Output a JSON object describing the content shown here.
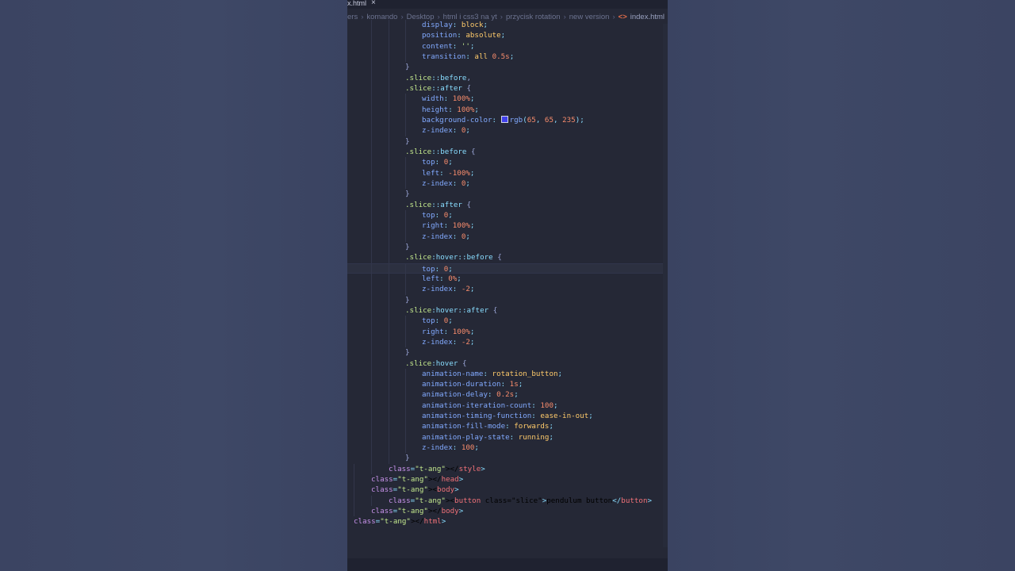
{
  "tab": {
    "title": "x.html",
    "close": "×"
  },
  "breadcrumbs": {
    "items": [
      "ers",
      "komando",
      "Desktop",
      "html i css3 na yt",
      "przycisk rotation",
      "new version"
    ],
    "file": "index.html"
  },
  "colors": {
    "swatch": "#4141eb",
    "accent": "#6a8cff"
  },
  "code_lines": [
    "display: block;",
    "position: absolute;",
    "content: '';",
    "transition: all 0.5s;",
    "}",
    ".slice::before,",
    ".slice::after {",
    "width: 100%;",
    "height: 100%;",
    "background-color: rgb(65, 65, 235);",
    "z-index: 0;",
    "}",
    ".slice::before {",
    "top: 0;",
    "left: -100%;",
    "z-index: 0;",
    "}",
    ".slice::after {",
    "top: 0;",
    "right: 100%;",
    "z-index: 0;",
    "}",
    ".slice:hover::before {",
    "top: 0;",
    "left: 0%;",
    "z-index: -2;",
    "}",
    ".slice:hover::after {",
    "top: 0;",
    "right: 100%;",
    "z-index: -2;",
    "}",
    ".slice:hover {",
    "animation-name: rotation_button;",
    "animation-duration: 1s;",
    "animation-delay: 0.2s;",
    "animation-iteration-count: 100;",
    "animation-timing-function: ease-in-out;",
    "animation-fill-mode: forwards;",
    "animation-play-state: running;",
    "z-index: 100;",
    "}",
    "</style>",
    "</head>",
    "<body>",
    "<button class=\"slice\">pendulum button</button>",
    "</body>",
    "</html>"
  ]
}
